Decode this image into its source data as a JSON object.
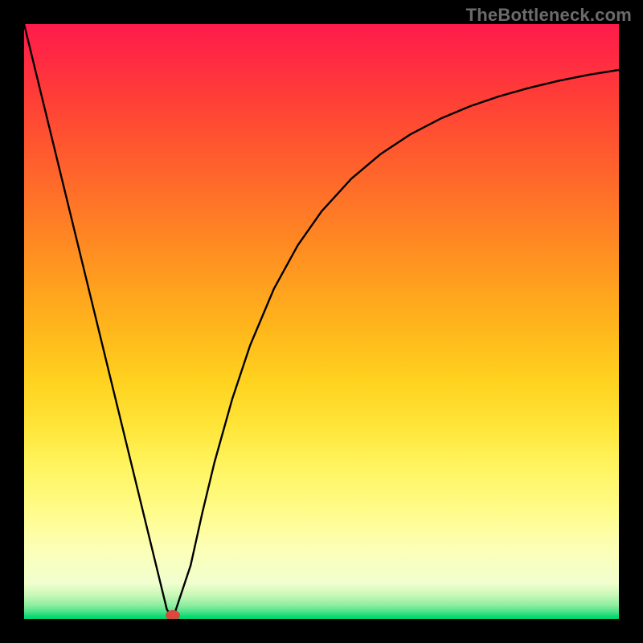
{
  "attribution": "TheBottleneck.com",
  "chart_data": {
    "type": "line",
    "title": "",
    "xlabel": "",
    "ylabel": "",
    "xlim": [
      0,
      100
    ],
    "ylim": [
      0,
      100
    ],
    "series": [
      {
        "name": "curve",
        "x": [
          0,
          5,
          10,
          15,
          20,
          22,
          24,
          25,
          28,
          30,
          32,
          35,
          38,
          42,
          46,
          50,
          55,
          60,
          65,
          70,
          75,
          80,
          85,
          90,
          95,
          100
        ],
        "y": [
          100,
          79.5,
          59,
          38.5,
          18,
          9.8,
          1.6,
          0,
          9,
          18,
          26.3,
          37,
          46,
          55.5,
          62.8,
          68.5,
          74,
          78.2,
          81.5,
          84.1,
          86.2,
          87.9,
          89.3,
          90.5,
          91.5,
          92.3
        ]
      }
    ],
    "marker": {
      "x": 25,
      "y": 0.6,
      "color": "#d84a3e"
    },
    "background_gradient": [
      "#ff1b4b",
      "#ff3d37",
      "#ff6e29",
      "#ffa01e",
      "#ffd21f",
      "#fff45e",
      "#fcffb5",
      "#8eeea0",
      "#00d66c"
    ]
  }
}
